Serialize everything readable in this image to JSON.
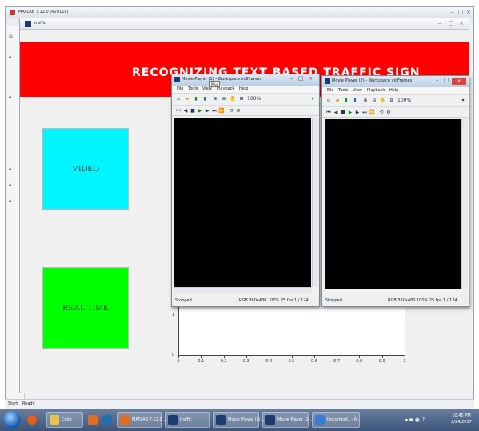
{
  "matlab": {
    "title": "MATLAB 7.12.0 (R2011a)",
    "status": "Ready",
    "start_label": "Start"
  },
  "figure": {
    "title": "traffic",
    "banner_title": "RECOGNIZING TEXT BASED TRAFFIC SIGN",
    "video_label": "VIDEO",
    "realtime_label": "REAL TIME"
  },
  "axes": {
    "y_ticks": [
      "1",
      "0"
    ],
    "x_ticks": [
      "0",
      "0.1",
      "0.2",
      "0.3",
      "0.4",
      "0.5",
      "0.6",
      "0.7",
      "0.8",
      "0.9",
      "1"
    ]
  },
  "player1": {
    "title": "Movie Player (1) - Workspace vidFrames",
    "menus": [
      "File",
      "Tools",
      "View",
      "Playback",
      "Help"
    ],
    "zoom": "100%",
    "status_left": "Stopped",
    "status_right": "RGB 360x480   100% 25 fps   1 / 124",
    "tooltip": "Play"
  },
  "player2": {
    "title": "Movie Player (2) - Workspace vidFrames",
    "menus": [
      "File",
      "Tools",
      "View",
      "Playback",
      "Help"
    ],
    "zoom": "100%",
    "status_left": "Stopped",
    "status_right": "RGB 360x480   100% 25 fps   1 / 124"
  },
  "taskbar": {
    "items": [
      "Code",
      "MATLAB 7.12.0 ...",
      "traffic",
      "Movie Player (1)...",
      "Movie Player (2)...",
      "Document1 - M..."
    ],
    "clock_time": "10:45 PM",
    "clock_date": "2/24/2017"
  },
  "colors": {
    "banner": "#ff0000",
    "video_button": "#00f5ff",
    "realtime_button": "#00ff00",
    "player_screen": "#000000"
  },
  "icons": [
    "matlab-icon",
    "play-icon",
    "stop-icon",
    "zoom-in-icon",
    "zoom-out-icon",
    "close-icon",
    "minimize-icon",
    "maximize-icon"
  ]
}
